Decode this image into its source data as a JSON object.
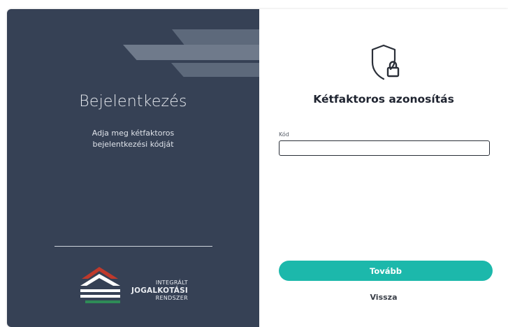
{
  "left_panel": {
    "title": "Bejelentkezés",
    "subtitle_line1": "Adja meg kétfaktoros",
    "subtitle_line2": "bejelentkezési kódját",
    "logo": {
      "line1": "INTEGRÁLT",
      "line2": "JOGALKOTÁSI",
      "line3": "RENDSZER"
    }
  },
  "right_panel": {
    "icon": "shield-lock-icon",
    "title": "Kétfaktoros azonosítás",
    "code_field": {
      "label": "Kód",
      "value": "",
      "placeholder": ""
    },
    "next_button": "Tovább",
    "back_link": "Vissza"
  },
  "colors": {
    "left_background": "#364155",
    "accent": "#1cb8ab",
    "logo_red": "#c0392b",
    "logo_green": "#2e8b57"
  }
}
